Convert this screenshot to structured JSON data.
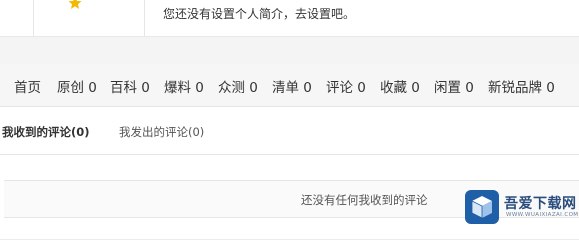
{
  "profile": {
    "hint": "您还没有设置个人简介，去设置吧。",
    "icon": "star-icon",
    "icon_color": "#f5b800"
  },
  "nav": {
    "items": [
      {
        "label": "首页"
      },
      {
        "label": "原创 0"
      },
      {
        "label": "百科 0"
      },
      {
        "label": "爆料 0"
      },
      {
        "label": "众测 0"
      },
      {
        "label": "清单 0"
      },
      {
        "label": "评论 0"
      },
      {
        "label": "收藏 0"
      },
      {
        "label": "闲置 0"
      },
      {
        "label": "新锐品牌 0"
      }
    ]
  },
  "comments": {
    "tabs": [
      {
        "label": "我收到的评论(0)",
        "active": true
      },
      {
        "label": "我发出的评论(0)",
        "active": false
      }
    ],
    "empty_text": "还没有任何我收到的评论"
  },
  "watermark": {
    "title": "吾爱下载网",
    "subtitle": "WWW.WUAIXIAZAI.COM",
    "icon": "cube-logo-icon",
    "color": "#2a4d7e"
  }
}
